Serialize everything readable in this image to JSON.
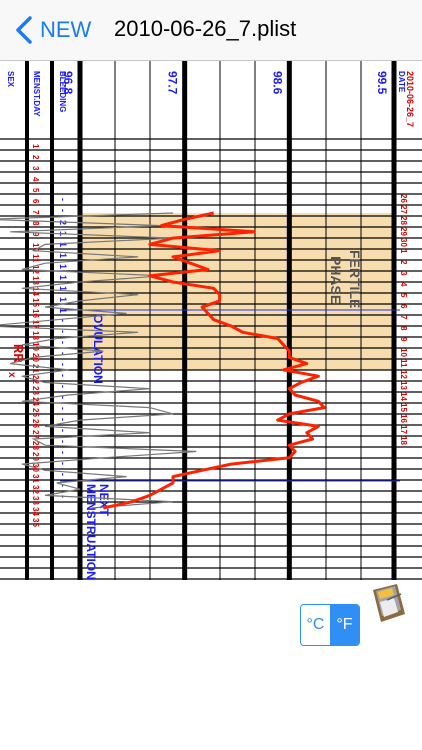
{
  "nav": {
    "back_label": "NEW",
    "title": "2010-06-26_7.plist"
  },
  "units": {
    "celsius": "°C",
    "fahrenheit": "°F",
    "selected": "fahrenheit"
  },
  "chart_data": {
    "type": "line",
    "columns": {
      "sex": "SEX",
      "menst_day": "MENST.DAY",
      "bleeding": "BLEEDING",
      "date": "DATE",
      "file_label": "2010-06-26_7"
    },
    "menst_days": [
      "1",
      "2",
      "3",
      "4",
      "5",
      "6",
      "7",
      "8",
      "9",
      "10",
      "11",
      "12",
      "13",
      "14",
      "15",
      "16",
      "17",
      "18",
      "19",
      "20",
      "21",
      "22",
      "23",
      "24",
      "25",
      "26",
      "27",
      "28",
      "29",
      "30",
      "31",
      "32",
      "33",
      "34",
      "35"
    ],
    "dates": [
      "26",
      "27",
      "28",
      "29",
      "30",
      "1",
      "2",
      "3",
      "4",
      "5",
      "6",
      "7",
      "8",
      "9",
      "10",
      "11",
      "12",
      "13",
      "14",
      "15",
      "16",
      "17",
      "18"
    ],
    "bleeding": [
      "-",
      "-",
      "2",
      "1",
      "1",
      "1",
      "1",
      "1",
      "1",
      "1",
      "1",
      "-",
      "-",
      "-",
      "-",
      "-",
      "-",
      "-",
      "-",
      "-",
      "-",
      "-",
      "-",
      "-",
      "-",
      "-",
      "-",
      "-"
    ],
    "temp_axis": [
      "96.8",
      "97.7",
      "98.6",
      "99.5"
    ],
    "temp_range": [
      96.8,
      99.5
    ],
    "annotations": {
      "fertile": "FERTILE\nPHASE",
      "ovulation": "OVULATION",
      "next": "NEXT\nMENSTRUATION",
      "rr": "RR",
      "rr_mark": "x"
    },
    "fertile_rows": [
      7,
      15
    ],
    "ovulation_row": 11,
    "next_row": 20,
    "temperature": [
      97.95,
      97.7,
      97.5,
      98.3,
      97.6,
      97.4,
      98.0,
      97.6,
      97.75,
      97.9,
      97.4,
      97.6,
      97.95,
      98.0,
      98.0,
      97.85,
      97.9,
      97.95,
      98.1,
      98.2,
      98.5,
      98.55,
      98.6,
      98.6,
      98.75,
      98.55,
      98.85,
      98.7,
      98.6,
      98.65,
      98.85,
      98.9,
      98.6,
      98.5,
      98.85,
      98.75,
      98.8,
      98.6,
      98.65,
      98.6,
      98.1,
      97.85,
      97.6,
      97.6,
      97.5,
      97.4,
      97.25,
      97.0
    ],
    "secondary": [
      97.6,
      96.0,
      97.5,
      96.2,
      97.6,
      96.5,
      96.4,
      97.3,
      96.5,
      96.3,
      97.5,
      96.8,
      96.3,
      97.3,
      96.8,
      96.5,
      97.2,
      96.6,
      96.0,
      97.3,
      96.6,
      96.3,
      97.0,
      96.4,
      96.2,
      96.7,
      96.3,
      96.5,
      97.4,
      96.7,
      96.3,
      97.4,
      97.6,
      96.8,
      96.5,
      97.4,
      96.4,
      96.5,
      97.8,
      97.0,
      96.3,
      96.5,
      97.2,
      96.6,
      96.8,
      96.5,
      97.6,
      96.9
    ]
  }
}
